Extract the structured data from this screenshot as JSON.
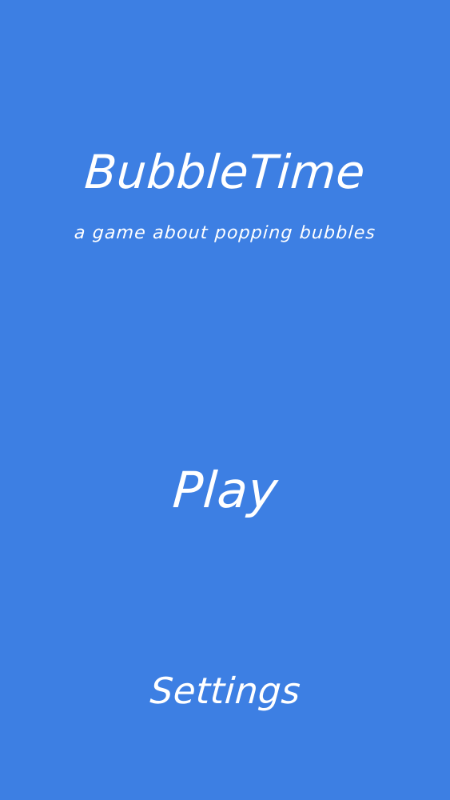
{
  "app": {
    "title": "BubbleTime",
    "subtitle": "a game about popping bubbles"
  },
  "menu": {
    "play_label": "Play",
    "settings_label": "Settings"
  },
  "colors": {
    "background": "#3d7fe3",
    "text": "#ffffff"
  }
}
